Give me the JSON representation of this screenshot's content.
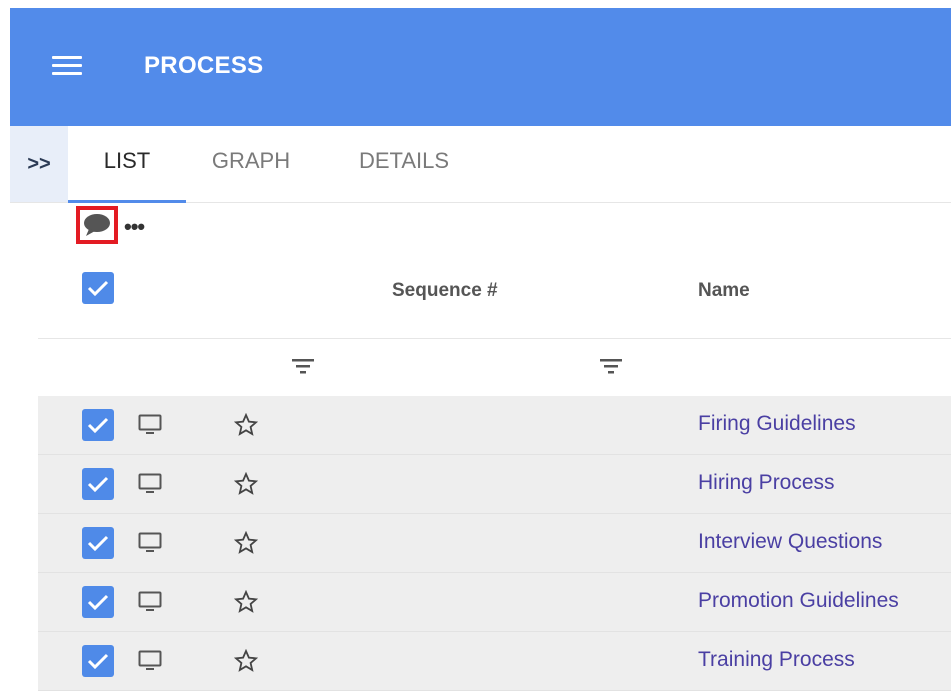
{
  "app": {
    "title": "PROCESS"
  },
  "tabs": [
    {
      "label": "LIST",
      "active": true
    },
    {
      "label": "GRAPH",
      "active": false
    },
    {
      "label": "DETAILS",
      "active": false
    }
  ],
  "expand_label": ">>",
  "toolbar": {
    "more_label": "•••"
  },
  "table": {
    "columns": [
      "Sequence #",
      "Name"
    ],
    "rows": [
      {
        "name": "Firing Guidelines",
        "checked": true
      },
      {
        "name": "Hiring Process",
        "checked": true
      },
      {
        "name": "Interview Questions",
        "checked": true
      },
      {
        "name": "Promotion Guidelines",
        "checked": true
      },
      {
        "name": "Training Process",
        "checked": true
      }
    ]
  },
  "colors": {
    "appbar": "#528bea",
    "checkbox": "#4f8ae8",
    "link": "#4a3fa3",
    "highlight": "#e31b23"
  },
  "icons": [
    "menu-icon",
    "comment-icon",
    "more-icon",
    "filter-icon",
    "monitor-icon",
    "star-outline-icon",
    "check-icon"
  ]
}
